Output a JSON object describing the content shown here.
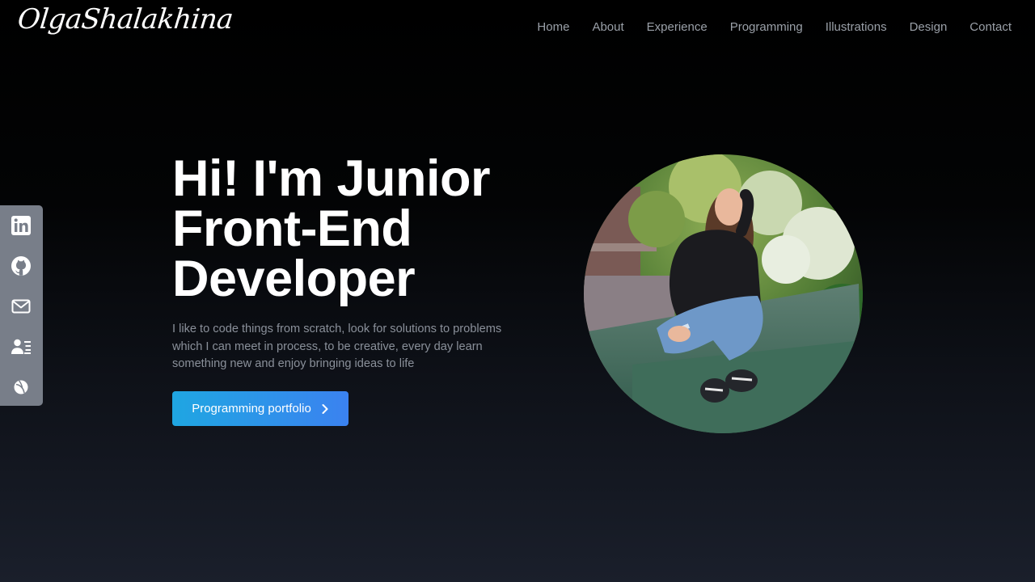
{
  "header": {
    "logo": "OlgaShalakhina",
    "nav": [
      "Home",
      "About",
      "Experience",
      "Programming",
      "Illustrations",
      "Design",
      "Contact"
    ]
  },
  "social": {
    "icons": [
      "linkedin-icon",
      "github-icon",
      "email-icon",
      "resume-icon",
      "dribbble-icon"
    ]
  },
  "hero": {
    "title": "Hi! I'm Junior Front-End Developer",
    "description": "I like to code things from scratch, look for solutions to problems which I can meet in process, to be creative, every day learn something new and enjoy bringing ideas to life",
    "cta_label": "Programming portfolio"
  },
  "colors": {
    "accent_start": "#1fa6e2",
    "accent_end": "#3b82f0",
    "nav_text": "#9aa0a8",
    "sidebar_bg": "#787e89"
  }
}
